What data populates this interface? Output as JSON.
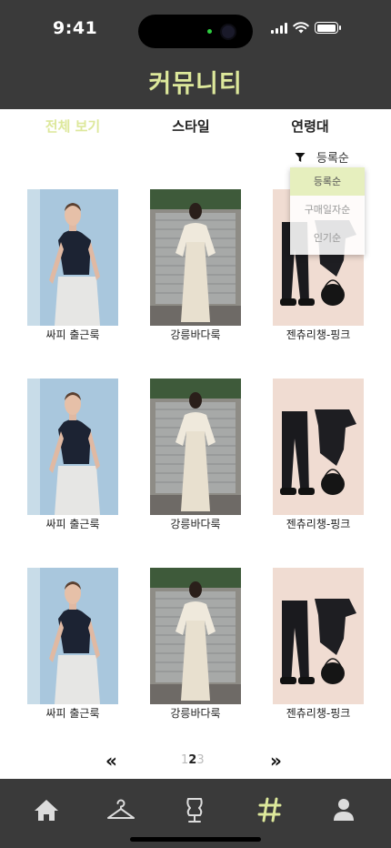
{
  "status_bar": {
    "time": "9:41"
  },
  "header": {
    "title": "커뮤니티"
  },
  "tabs": [
    {
      "label": "전체 보기",
      "active": true
    },
    {
      "label": "스타일",
      "active": false
    },
    {
      "label": "연령대",
      "active": false
    }
  ],
  "sort": {
    "icon": "filter-icon",
    "label": "등록순",
    "options": [
      "등록순",
      "구매일자순",
      "인기순"
    ],
    "selected": "등록순"
  },
  "posts": [
    {
      "caption": "싸피 출근룩"
    },
    {
      "caption": "강릉바다룩"
    },
    {
      "caption": "젠츄리챙-핑크"
    },
    {
      "caption": "싸피 출근룩"
    },
    {
      "caption": "강릉바다룩"
    },
    {
      "caption": "젠츄리챙-핑크"
    },
    {
      "caption": "싸피 출근룩"
    },
    {
      "caption": "강릉바다룩"
    },
    {
      "caption": "젠츄리챙-핑크"
    }
  ],
  "pagination": {
    "prev": "«",
    "next": "»",
    "pages": [
      "1",
      "2",
      "3"
    ],
    "current": "2"
  },
  "bottom_nav": [
    {
      "icon": "home-icon"
    },
    {
      "icon": "hanger-icon"
    },
    {
      "icon": "mannequin-icon"
    },
    {
      "icon": "hashtag-icon",
      "active": true
    },
    {
      "icon": "profile-icon"
    }
  ],
  "colors": {
    "accent": "#dde89b",
    "bar": "#3a3a3a",
    "selected_option": "#e6efbe"
  }
}
